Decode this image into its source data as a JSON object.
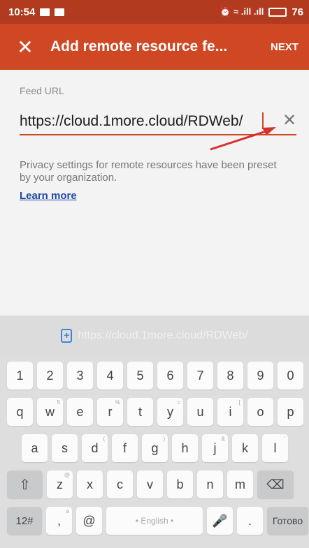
{
  "status_bar": {
    "time": "10:54",
    "signal_text": "⏰ ≈ .ill .ıll",
    "battery": "76"
  },
  "appbar": {
    "title": "Add remote resource fe...",
    "next_label": "NEXT"
  },
  "form": {
    "feed_label": "Feed URL",
    "url_value": "https://cloud.1more.cloud/RDWeb/",
    "privacy_text": "Privacy settings for remote resources have been preset by your organization.",
    "learn_more": "Learn more"
  },
  "suggestion": {
    "text": "https://cloud.1more.cloud/RDWeb/"
  },
  "keyboard": {
    "numbers": [
      "1",
      "2",
      "3",
      "4",
      "5",
      "6",
      "7",
      "8",
      "9",
      "0"
    ],
    "row1": [
      "q",
      "w",
      "e",
      "r",
      "t",
      "y",
      "u",
      "i",
      "o",
      "p"
    ],
    "row1_hints": [
      "",
      "5",
      "",
      "%",
      "",
      "=",
      "",
      "[",
      "",
      ""
    ],
    "row2": [
      "a",
      "s",
      "d",
      "f",
      "g",
      "h",
      "j",
      "k",
      "l"
    ],
    "row2_hints": [
      "",
      "",
      "(",
      "",
      ")",
      "",
      "&",
      "",
      "'"
    ],
    "row3": [
      "z",
      "x",
      "c",
      "v",
      "b",
      "n",
      "m"
    ],
    "row3_hints": [
      "@",
      "",
      "",
      "",
      "",
      "",
      ""
    ],
    "shift": "⇧",
    "backspace": "⌫",
    "symbols": "12#",
    "comma": ",",
    "comma_hint": "a",
    "at": "@",
    "space": "• English •",
    "mic": "🎤",
    "period": ".",
    "done": "Готово"
  },
  "colors": {
    "appbar": "#d04723",
    "statusbar": "#b13a1f",
    "arrow": "#d8312b",
    "link": "#1f4aa8"
  }
}
